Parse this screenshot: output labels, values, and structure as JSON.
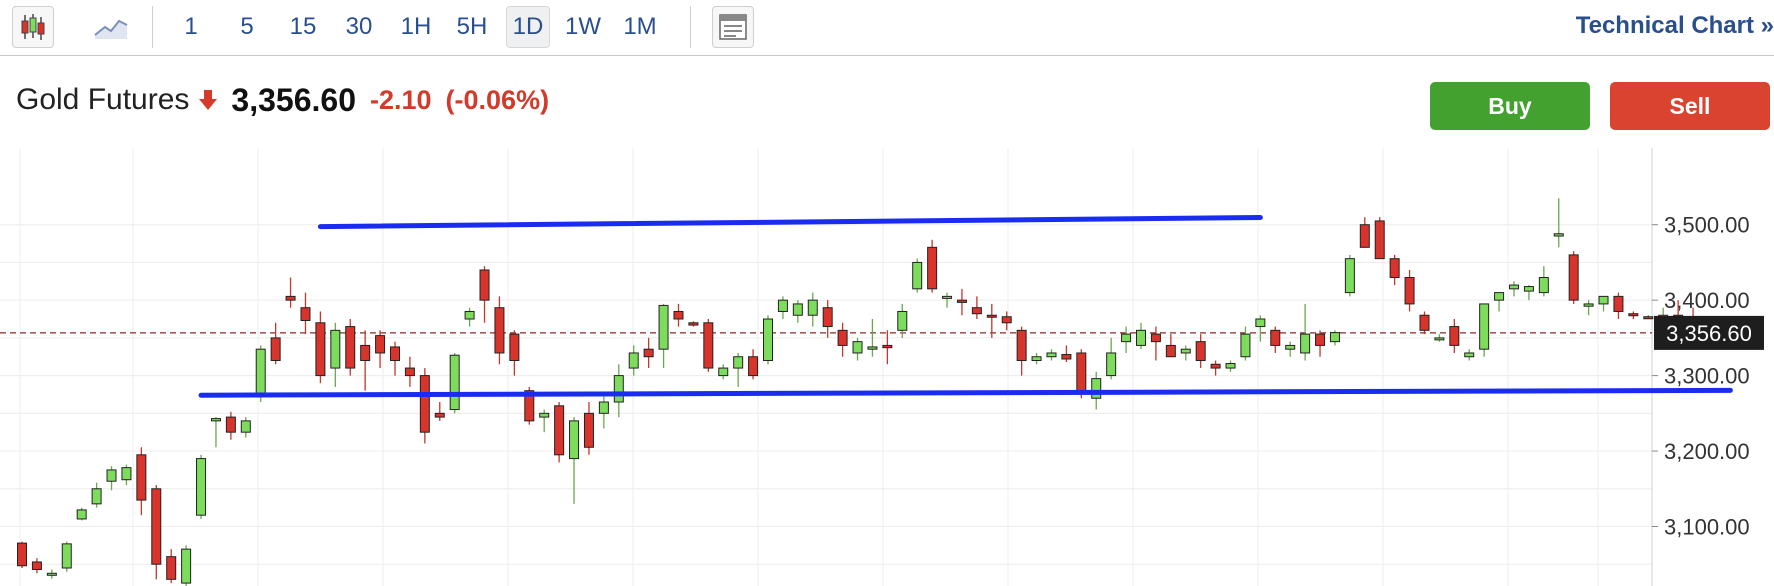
{
  "toolbar": {
    "chart_type_icons": [
      "candlestick-icon",
      "line-chart-icon"
    ],
    "intervals": [
      "1",
      "5",
      "15",
      "30",
      "1H",
      "5H",
      "1D",
      "1W",
      "1M"
    ],
    "active_interval": "1D",
    "layout_icon": "layout-icon",
    "technical_chart_label": "Technical Chart »"
  },
  "quote": {
    "name": "Gold Futures",
    "direction_icon": "down-arrow-icon",
    "price": "3,356.60",
    "change": "-2.10",
    "change_pct": "(-0.06%)"
  },
  "actions": {
    "buy": "Buy",
    "sell": "Sell"
  },
  "colors": {
    "up": "#7ddc5c",
    "down": "#d9342b",
    "trendline": "#1a2cf0",
    "link": "#2a4f8f",
    "buy": "#43a22f",
    "sell": "#d9432f"
  },
  "chart_data": {
    "type": "candlestick",
    "y_ticks": [
      3100,
      3200,
      3300,
      3400,
      3500
    ],
    "y_tick_labels": [
      "3,100.00",
      "3,200.00",
      "3,300.00",
      "3,400.00",
      "3,500.00"
    ],
    "ylim": [
      3020,
      3570
    ],
    "grid": true,
    "last_price": 3356.6,
    "last_price_label": "3,356.60",
    "candles": [
      [
        3078,
        3080,
        3045,
        3048
      ],
      [
        3053,
        3058,
        3038,
        3043
      ],
      [
        3036,
        3043,
        3031,
        3038
      ],
      [
        3045,
        3080,
        3040,
        3077
      ],
      [
        3110,
        3125,
        3108,
        3122
      ],
      [
        3130,
        3158,
        3125,
        3150
      ],
      [
        3160,
        3180,
        3148,
        3175
      ],
      [
        3162,
        3182,
        3155,
        3178
      ],
      [
        3195,
        3205,
        3115,
        3135
      ],
      [
        3150,
        3155,
        3030,
        3050
      ],
      [
        3060,
        3070,
        3025,
        3030
      ],
      [
        3025,
        3075,
        3018,
        3070
      ],
      [
        3115,
        3195,
        3110,
        3190
      ],
      [
        3240,
        3245,
        3205,
        3243
      ],
      [
        3245,
        3252,
        3215,
        3225
      ],
      [
        3225,
        3245,
        3218,
        3240
      ],
      [
        3275,
        3340,
        3265,
        3335
      ],
      [
        3350,
        3370,
        3315,
        3320
      ],
      [
        3405,
        3430,
        3390,
        3400
      ],
      [
        3390,
        3410,
        3355,
        3373
      ],
      [
        3370,
        3385,
        3290,
        3300
      ],
      [
        3310,
        3370,
        3285,
        3360
      ],
      [
        3365,
        3375,
        3300,
        3310
      ],
      [
        3340,
        3360,
        3280,
        3320
      ],
      [
        3353,
        3360,
        3310,
        3330
      ],
      [
        3338,
        3345,
        3300,
        3320
      ],
      [
        3310,
        3325,
        3285,
        3300
      ],
      [
        3300,
        3310,
        3210,
        3225
      ],
      [
        3250,
        3265,
        3240,
        3245
      ],
      [
        3255,
        3330,
        3250,
        3327
      ],
      [
        3375,
        3390,
        3365,
        3385
      ],
      [
        3440,
        3445,
        3370,
        3400
      ],
      [
        3390,
        3405,
        3315,
        3330
      ],
      [
        3355,
        3360,
        3300,
        3320
      ],
      [
        3280,
        3285,
        3235,
        3240
      ],
      [
        3245,
        3255,
        3225,
        3250
      ],
      [
        3260,
        3265,
        3185,
        3195
      ],
      [
        3190,
        3245,
        3130,
        3240
      ],
      [
        3250,
        3265,
        3195,
        3205
      ],
      [
        3250,
        3275,
        3230,
        3265
      ],
      [
        3265,
        3315,
        3245,
        3300
      ],
      [
        3310,
        3340,
        3300,
        3330
      ],
      [
        3335,
        3350,
        3310,
        3325
      ],
      [
        3335,
        3395,
        3310,
        3393
      ],
      [
        3385,
        3395,
        3365,
        3375
      ],
      [
        3370,
        3372,
        3365,
        3367
      ],
      [
        3370,
        3375,
        3305,
        3310
      ],
      [
        3300,
        3315,
        3295,
        3310
      ],
      [
        3310,
        3330,
        3285,
        3325
      ],
      [
        3325,
        3335,
        3295,
        3300
      ],
      [
        3320,
        3380,
        3315,
        3375
      ],
      [
        3385,
        3405,
        3375,
        3400
      ],
      [
        3380,
        3400,
        3370,
        3395
      ],
      [
        3380,
        3410,
        3365,
        3400
      ],
      [
        3390,
        3400,
        3350,
        3365
      ],
      [
        3360,
        3370,
        3325,
        3340
      ],
      [
        3330,
        3350,
        3320,
        3345
      ],
      [
        3335,
        3375,
        3325,
        3338
      ],
      [
        3340,
        3360,
        3315,
        3337
      ],
      [
        3360,
        3395,
        3350,
        3385
      ],
      [
        3415,
        3455,
        3410,
        3450
      ],
      [
        3470,
        3480,
        3410,
        3415
      ],
      [
        3403,
        3410,
        3390,
        3405
      ],
      [
        3400,
        3415,
        3380,
        3397
      ],
      [
        3390,
        3405,
        3375,
        3382
      ],
      [
        3380,
        3395,
        3350,
        3378
      ],
      [
        3378,
        3385,
        3360,
        3370
      ],
      [
        3360,
        3365,
        3300,
        3320
      ],
      [
        3320,
        3330,
        3315,
        3325
      ],
      [
        3325,
        3335,
        3320,
        3330
      ],
      [
        3328,
        3340,
        3318,
        3322
      ],
      [
        3330,
        3335,
        3270,
        3276
      ],
      [
        3270,
        3305,
        3255,
        3296
      ],
      [
        3300,
        3350,
        3295,
        3330
      ],
      [
        3345,
        3365,
        3330,
        3355
      ],
      [
        3340,
        3370,
        3335,
        3360
      ],
      [
        3355,
        3365,
        3320,
        3345
      ],
      [
        3340,
        3355,
        3330,
        3325
      ],
      [
        3330,
        3340,
        3320,
        3335
      ],
      [
        3345,
        3355,
        3310,
        3320
      ],
      [
        3315,
        3320,
        3300,
        3310
      ],
      [
        3310,
        3320,
        3305,
        3316
      ],
      [
        3325,
        3365,
        3320,
        3355
      ],
      [
        3365,
        3380,
        3345,
        3375
      ],
      [
        3360,
        3365,
        3330,
        3340
      ],
      [
        3335,
        3345,
        3325,
        3340
      ],
      [
        3330,
        3395,
        3320,
        3355
      ],
      [
        3355,
        3360,
        3325,
        3340
      ],
      [
        3345,
        3360,
        3340,
        3357
      ],
      [
        3410,
        3460,
        3405,
        3455
      ],
      [
        3500,
        3510,
        3475,
        3470
      ],
      [
        3505,
        3510,
        3455,
        3455
      ],
      [
        3455,
        3460,
        3420,
        3430
      ],
      [
        3430,
        3440,
        3385,
        3395
      ],
      [
        3380,
        3385,
        3355,
        3360
      ],
      [
        3350,
        3355,
        3345,
        3350
      ],
      [
        3365,
        3375,
        3330,
        3340
      ],
      [
        3325,
        3335,
        3320,
        3330
      ],
      [
        3335,
        3375,
        3325,
        3395
      ],
      [
        3400,
        3410,
        3385,
        3410
      ],
      [
        3415,
        3425,
        3405,
        3420
      ],
      [
        3412,
        3420,
        3400,
        3418
      ],
      [
        3410,
        3445,
        3405,
        3430
      ],
      [
        3485,
        3535,
        3470,
        3488
      ],
      [
        3460,
        3465,
        3395,
        3400
      ],
      [
        3392,
        3400,
        3380,
        3395
      ],
      [
        3395,
        3405,
        3385,
        3405
      ],
      [
        3405,
        3410,
        3375,
        3385
      ],
      [
        3382,
        3385,
        3375,
        3380
      ],
      [
        3378,
        3380,
        3375,
        3377
      ],
      [
        3378,
        3390,
        3370,
        3380
      ],
      [
        3380,
        3400,
        3360,
        3378
      ],
      [
        3375,
        3390,
        3355,
        3357
      ]
    ],
    "trendlines": [
      {
        "x0": 20,
        "y0": 3497.5,
        "x1": 83,
        "y1": 3509.5
      },
      {
        "x0": 12,
        "y0": 3274,
        "x1": 114.5,
        "y1": 3280.5
      }
    ]
  }
}
